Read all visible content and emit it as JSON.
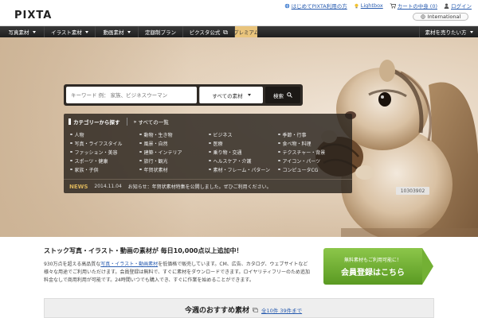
{
  "brand": {
    "logo": "PIXTA"
  },
  "header": {
    "links": [
      {
        "name": "help-link",
        "label": "はじめてPIXTA利用の方",
        "icon": "globe-icon"
      },
      {
        "name": "lightbox-link",
        "label": "Lightbox",
        "icon": "bulb-icon"
      },
      {
        "name": "cart-link",
        "label": "カートの中身 (0)",
        "icon": "cart-icon"
      },
      {
        "name": "login-link",
        "label": "ログイン",
        "icon": "user-icon"
      }
    ],
    "language": "International"
  },
  "nav": {
    "items": [
      {
        "id": "ni1",
        "label": "写真素材",
        "caret": true
      },
      {
        "id": "ni2",
        "label": "イラスト素材",
        "caret": true
      },
      {
        "id": "ni3",
        "label": "動画素材",
        "caret": true
      },
      {
        "id": "ni4",
        "label": "定額制プラン",
        "caret": false
      },
      {
        "id": "ni5",
        "label": "ピクスタ公式",
        "caret": false
      },
      {
        "id": "ni6",
        "label": "プレミアム",
        "caret": false
      }
    ],
    "right": "素材を売りたい方"
  },
  "search": {
    "placeholder": "キーワード 例： 家族、ビジネスウーマン",
    "select_value": "すべての素材",
    "button": "検索"
  },
  "categories": {
    "tab_main": "カテゴリーから探す",
    "tab_sub": "すべての一覧",
    "items": [
      "人物",
      "動物・生き物",
      "ビジネス",
      "季節・行事",
      "写真・ライフスタイル",
      "風景・自然",
      "医療",
      "食べ物・料理",
      "ファッション・美容",
      "建築・インテリア",
      "乗り物・交通",
      "テクスチャー・背景",
      "スポーツ・健康",
      "旅行・観光",
      "ヘルスケア・介護",
      "アイコン・パーツ",
      "家族・子供",
      "年賀状素材",
      "素材・フレーム・パターン",
      "コンピュータCG"
    ]
  },
  "news": {
    "label": "NEWS",
    "date": "2014.11.04",
    "text": "お知らせ：年賀状素材特集を公開しました。ぜひご利用ください。"
  },
  "photo_id": "10303902",
  "promo": {
    "title": "ストック写真・イラスト・動画の素材が 毎日10,000点以上追加中！",
    "body_prefix": "930万点を超える高品質な",
    "body_link": "写真・イラスト・動画素材",
    "body_suffix": "を低価格で販売しています。CM、広告、カタログ、ウェブサイトなど様々な用途でご利用いただけます。会員登録は無料で、すぐに素材をダウンロードできます。ロイヤリティフリーのため追加料金なしで商用利用が可能です。24時間いつでも購入でき、すぐに作業を始めることができます。"
  },
  "cta": {
    "sub": "無料素材もご利用可能に！",
    "main": "会員登録はこちら"
  },
  "bottom": {
    "title": "今週のおすすめ素材",
    "count": "全10件 39件まで"
  },
  "colors": {
    "nav_bg": "#1e1e1e",
    "premium_tab": "#e9c47c",
    "cta_green": "#6aab30",
    "link_blue": "#2a5db0",
    "news_label": "#d9b35a"
  }
}
